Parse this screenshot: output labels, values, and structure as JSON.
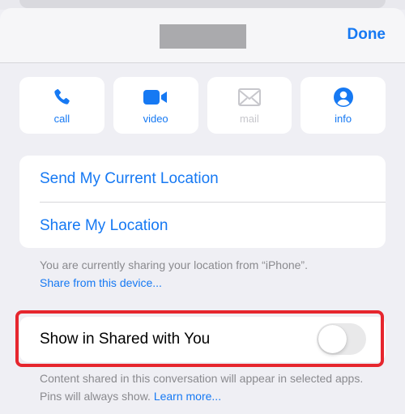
{
  "header": {
    "done_label": "Done"
  },
  "actions": [
    {
      "label": "call",
      "icon": "phone-icon",
      "enabled": true
    },
    {
      "label": "video",
      "icon": "video-camera-icon",
      "enabled": true
    },
    {
      "label": "mail",
      "icon": "envelope-icon",
      "enabled": false
    },
    {
      "label": "info",
      "icon": "person-circle-icon",
      "enabled": true
    }
  ],
  "location": {
    "send_current": "Send My Current Location",
    "share": "Share My Location",
    "note": "You are currently sharing your location from “iPhone”.",
    "share_from_device": "Share from this device..."
  },
  "shared_with_you": {
    "label": "Show in Shared with You",
    "enabled": false,
    "note": "Content shared in this conversation will appear in selected apps. Pins will always show.",
    "learn_more": "Learn more..."
  },
  "colors": {
    "accent": "#1679f3",
    "disabled": "#c7c7cc",
    "highlight": "#e6262e",
    "background": "#efeff4"
  }
}
